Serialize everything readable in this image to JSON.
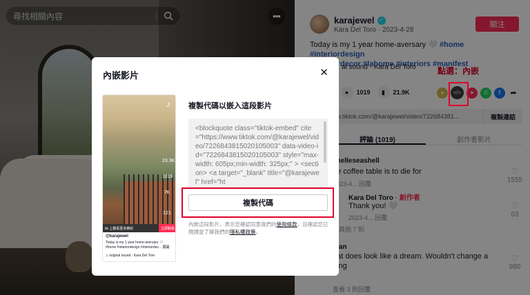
{
  "search": {
    "placeholder": "尋找相關內容"
  },
  "author": {
    "username": "karajewel",
    "subline": "Kara Del Toro · 2023-4-28",
    "follow_label": "關注"
  },
  "caption": {
    "text": "Today is my 1 year home-aversary 🤍 ",
    "tags": [
      "#home",
      "#interiordesign",
      "#interiordecor",
      "#lahome",
      "#interiors",
      "#manifest"
    ]
  },
  "music": "al sound - Kara Del Toro",
  "annotation": "點選：內嵌",
  "stats": {
    "likes": "K",
    "comments": "1019",
    "saves": "21.9K"
  },
  "link": {
    "url": "ww.tiktok.com/@karajewel/video/722684381...",
    "copy_label": "複製連結"
  },
  "tabs": [
    {
      "label": "評論 (1019)"
    },
    {
      "label": "創作者影片"
    }
  ],
  "comments": [
    {
      "name": "chelleseashell",
      "text": "he coffee table is to die for",
      "meta": "2023-4...   回覆",
      "likes": "1555"
    },
    {
      "name": "Kara Del Toro",
      "badge": "· 創作者",
      "text": "Thank you! 🤍",
      "meta": "2023-4...   回覆",
      "likes": "63"
    },
    {
      "more": "看其他 7 則"
    },
    {
      "name": "man",
      "text": "hat does look like a dream. Wouldn't change a",
      "text2": "hing",
      "meta": "2023-4...   回覆",
      "likes": "980"
    },
    {
      "more": "查看 3 則回覆"
    }
  ],
  "modal": {
    "title": "內嵌影片",
    "heading": "複製代碼以嵌入這段影片",
    "code": "<blockquote class=\"tiktok-embed\" cite=\"https://www.tiktok.com/@karajewel/video/7226843815020105003\" data-video-id=\"7226843815020105003\" style=\"max-width: 605px;min-width: 325px;\" > <section> <a target=\"_blank\" title=\"@karajewel\" href=\"ht",
    "copy_label": "複製代碼",
    "terms_prefix": "內嵌這段影片，表示您確認同意我們的",
    "terms_link": "使用條款",
    "terms_mid": "，且確認您已閱讀並了解我們的",
    "privacy_link": "隱私權政策",
    "terms_suffix": "。"
  },
  "preview": {
    "bar_text": "tik 上觀看更多精彩",
    "bar_button": "立即觀看",
    "user": "@karajewel",
    "caption": "Today is my 1 year home-aversary 🤍 #home #interiordesign #interiordec... 展開",
    "music": "♫ original sound - Kara Del Toro",
    "side_counts": [
      "23.3K",
      "1019",
      "7K",
      "121"
    ]
  },
  "colors": {
    "brand": "#fe2c55",
    "annotation": "#e0002a",
    "hashtag": "#2b5db9"
  }
}
